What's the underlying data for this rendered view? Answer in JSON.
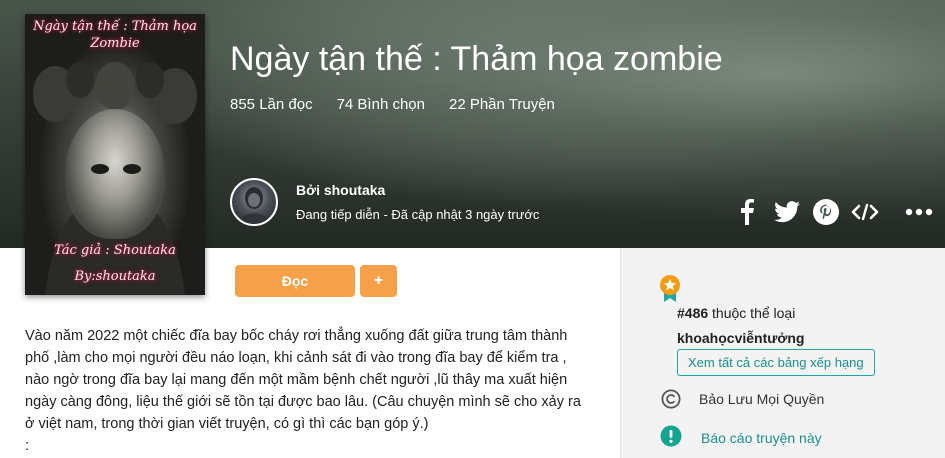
{
  "story": {
    "title": "Ngày tận thế : Thảm họa zombie",
    "stats": {
      "reads": "855 Lần đọc",
      "votes": "74 Bình chọn",
      "parts": "22 Phần Truyện"
    }
  },
  "cover": {
    "title_line1": "Ngày tận thế : Thảm họa",
    "title_line2": "Zombie",
    "author_line1": "Tác giả : Shoutaka",
    "author_line2": "By:shoutaka"
  },
  "author": {
    "byline": "Bởi shoutaka",
    "status": "Đang tiếp diễn - Đã cập nhật 3 ngày trước"
  },
  "share": {
    "icons": [
      "facebook-icon",
      "twitter-icon",
      "pinterest-icon",
      "embed-icon",
      "more-icon"
    ]
  },
  "actions": {
    "read_label": "Đọc",
    "add_label": "+"
  },
  "description": {
    "line1": "Vào năm 2022 một chiếc đĩa bay bốc cháy rơi thẳng xuống đất giữa trung tâm thành",
    "line2": "phố ,làm cho mọi người đều náo loạn, khi cảnh sát đi vào trong đĩa bay để kiểm tra ,",
    "line3": "nào ngờ trong đĩa bay lại mang đến một mầm bệnh chết người ,lũ thây ma xuất hiện",
    "line4": "ngày càng đông, liệu thế giới sẽ tồn tại được bao lâu. (Câu chuyện mình sẽ cho xảy ra",
    "line5": "ở việt nam, trong thời gian viết truyện, có gì thì các bạn góp ý.)",
    "line6": ":"
  },
  "sidebar": {
    "rank_number": "#486",
    "rank_suffix": " thuộc thể loại",
    "rank_category": "khoahọcviễntưởng",
    "rank_link": "Xem tất cả các bảng xếp hạng",
    "copyright": "Bảo Lưu Mọi Quyền",
    "report": "Báo cáo truyện này"
  },
  "colors": {
    "accent_orange": "#f6a14a",
    "teal": "#1fa7a8",
    "badge_star": "#f39c12"
  }
}
